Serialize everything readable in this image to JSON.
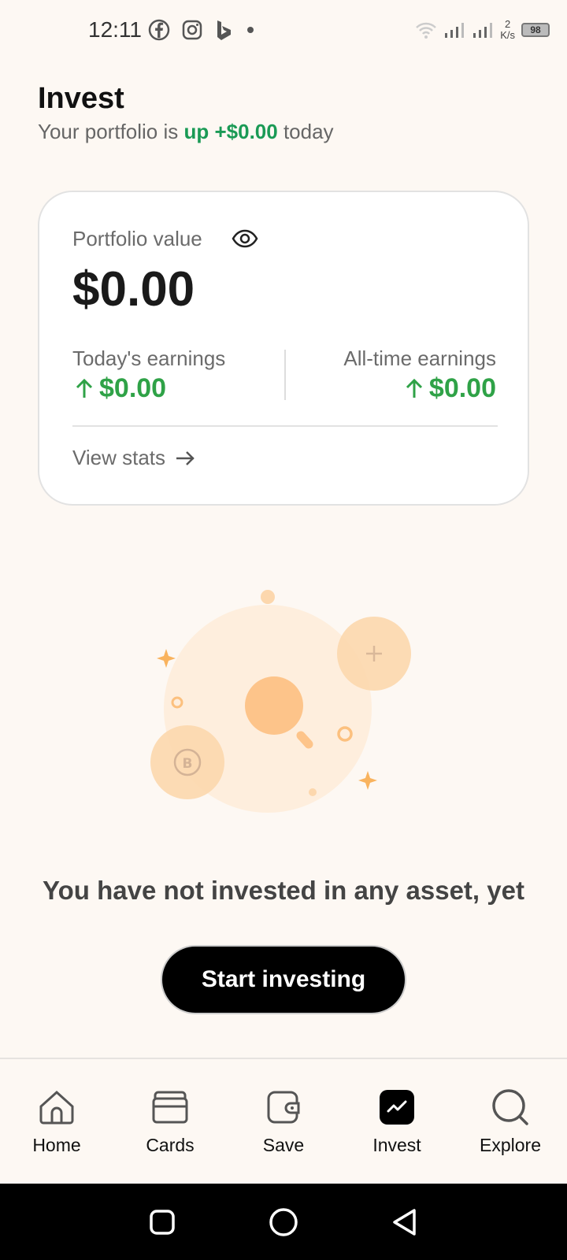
{
  "status_bar": {
    "time": "12:11",
    "speed_value": "2",
    "speed_unit": "K/s",
    "battery": "98"
  },
  "header": {
    "title": "Invest",
    "subtitle_prefix": "Your portfolio is ",
    "subtitle_change": "up +$0.00",
    "subtitle_suffix": " today"
  },
  "portfolio": {
    "label": "Portfolio value",
    "value": "$0.00",
    "todays_label": "Today's earnings",
    "todays_value": "$0.00",
    "alltime_label": "All-time earnings",
    "alltime_value": "$0.00",
    "view_stats": "View stats"
  },
  "empty_state": {
    "message": "You have not invested in any asset, yet",
    "button": "Start investing"
  },
  "bottom_nav": {
    "items": [
      {
        "label": "Home",
        "icon": "home-icon"
      },
      {
        "label": "Cards",
        "icon": "cards-icon"
      },
      {
        "label": "Save",
        "icon": "wallet-icon"
      },
      {
        "label": "Invest",
        "icon": "invest-icon",
        "active": true
      },
      {
        "label": "Explore",
        "icon": "search-icon"
      }
    ]
  },
  "colors": {
    "background": "#fdf8f3",
    "positive": "#2fa247",
    "accent_orange": "#f9b35e"
  }
}
